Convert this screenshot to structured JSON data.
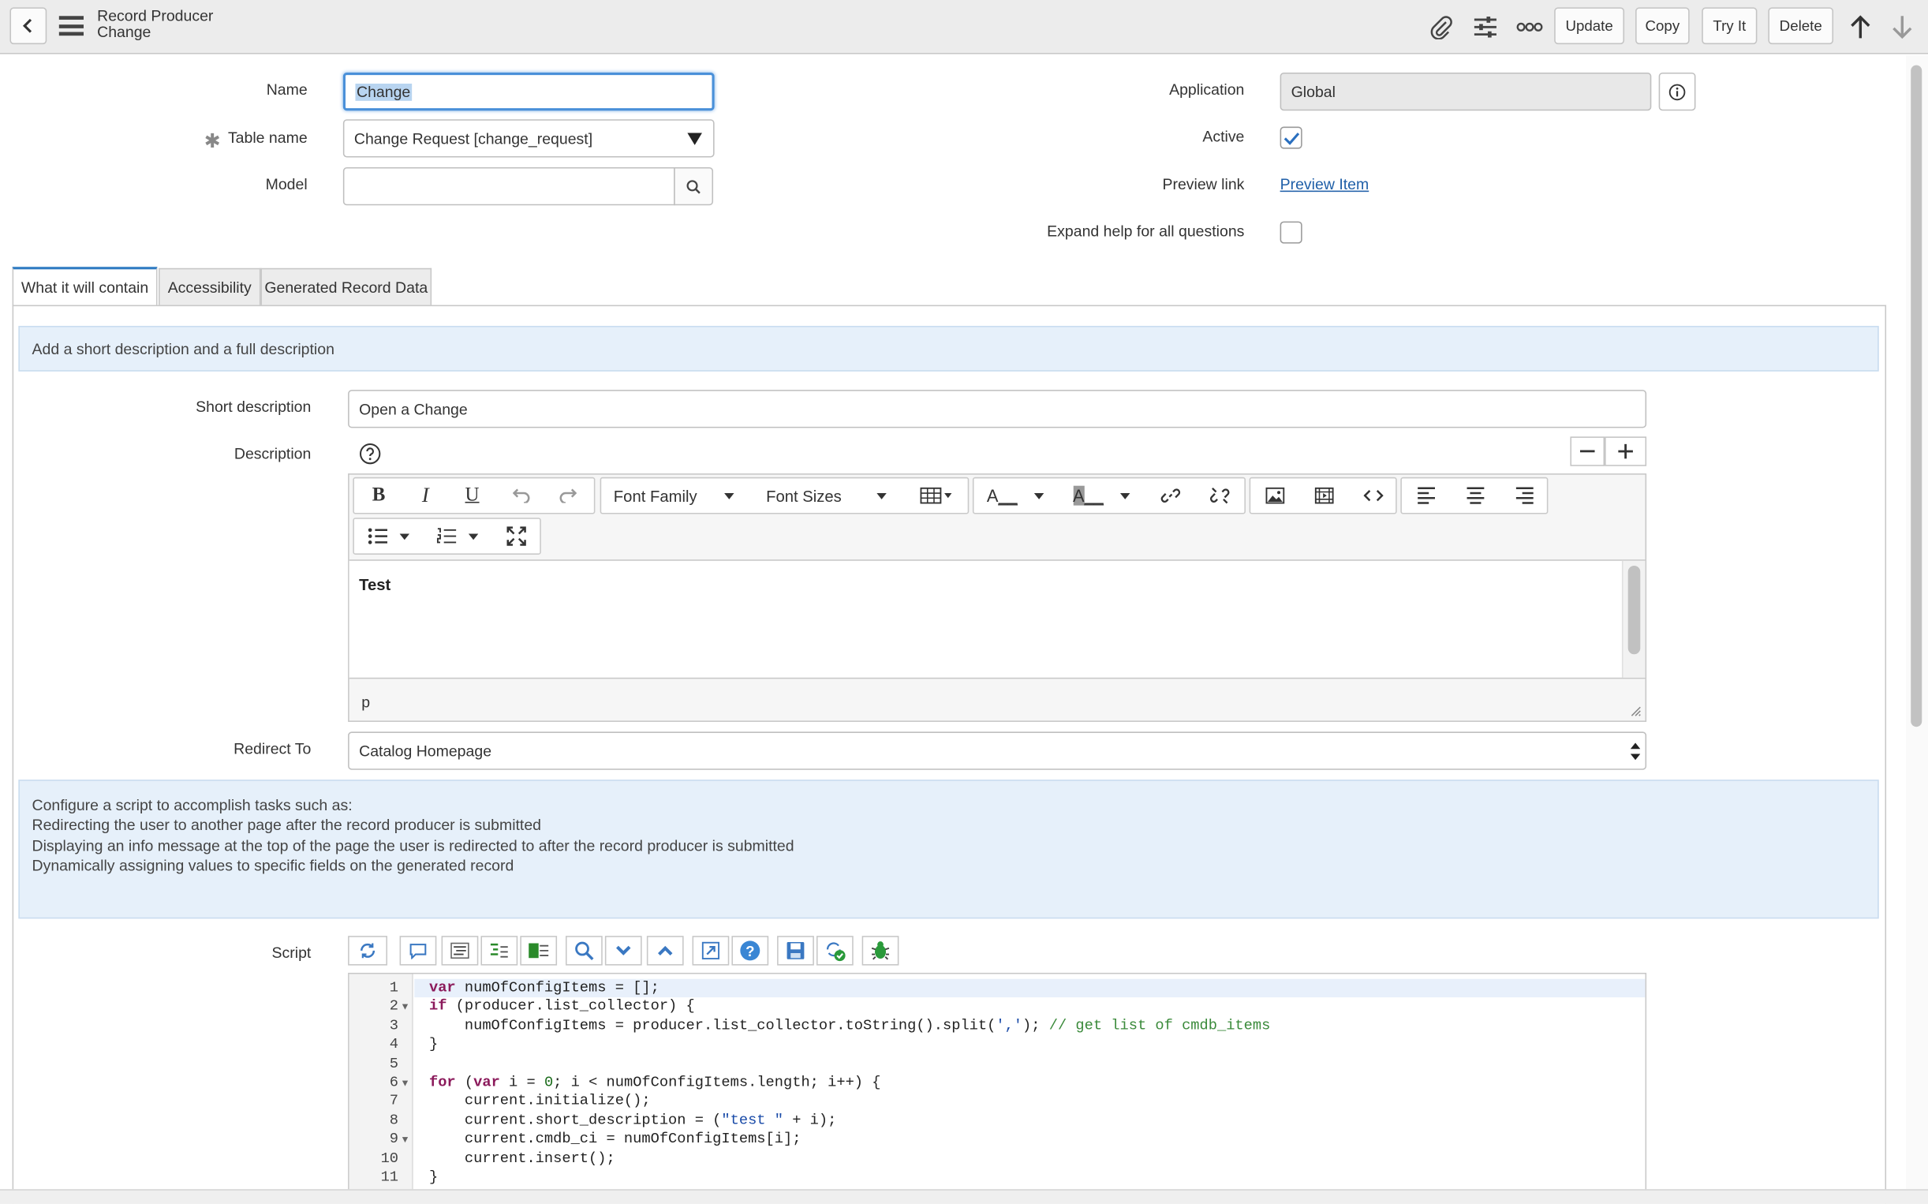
{
  "header": {
    "title": "Record Producer",
    "subtitle": "Change",
    "buttons": {
      "update": "Update",
      "copy": "Copy",
      "try_it": "Try It",
      "delete": "Delete"
    }
  },
  "form": {
    "name_label": "Name",
    "name_value": "Change",
    "table_label": "Table name",
    "table_value": "Change Request [change_request]",
    "model_label": "Model",
    "model_value": "",
    "application_label": "Application",
    "application_value": "Global",
    "active_label": "Active",
    "active_checked": true,
    "preview_label": "Preview link",
    "preview_link": "Preview Item",
    "expand_label": "Expand help for all questions",
    "expand_checked": false
  },
  "tabs": [
    {
      "label": "What it will contain",
      "active": true
    },
    {
      "label": "Accessibility",
      "active": false
    },
    {
      "label": "Generated Record Data",
      "active": false
    }
  ],
  "info_note": "Add a short description and a full description",
  "short_description": {
    "label": "Short description",
    "value": "Open a Change"
  },
  "description": {
    "label": "Description",
    "toolbar": {
      "font_family": "Font Family",
      "font_sizes": "Font Sizes"
    },
    "content": "Test",
    "status_path": "p"
  },
  "redirect": {
    "label": "Redirect To",
    "value": "Catalog Homepage"
  },
  "script_note": [
    "Configure a script to accomplish tasks such as:",
    "Redirecting the user to another page after the record producer is submitted",
    "Displaying an info message at the top of the page the user is redirected to after the record producer is submitted",
    "Dynamically assigning values to specific fields on the generated record"
  ],
  "script": {
    "label": "Script",
    "line_numbers": [
      "1",
      "2",
      "3",
      "4",
      "5",
      "6",
      "7",
      "8",
      "9",
      "10",
      "11"
    ]
  }
}
